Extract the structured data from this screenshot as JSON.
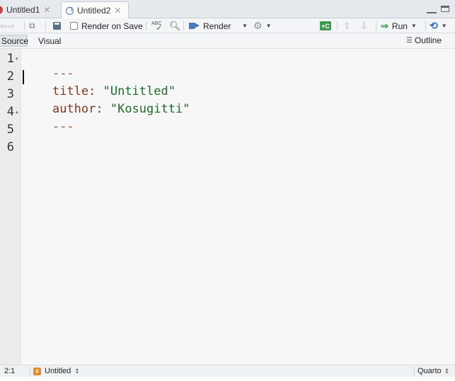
{
  "tabs": [
    {
      "label": "Untitled1",
      "active": false,
      "icon": "r-script-icon"
    },
    {
      "label": "Untitled2",
      "active": true,
      "icon": "quarto-doc-icon"
    }
  ],
  "toolbar": {
    "render_on_save_label": "Render on Save",
    "render_on_save_checked": false,
    "spell_icon_text": "ABC",
    "render_label": "Render",
    "insert_chunk_text": "C",
    "run_label": "Run"
  },
  "modes": {
    "source_label": "Source",
    "visual_label": "Visual",
    "outline_label": "Outline"
  },
  "editor": {
    "lines": [
      {
        "number": "1",
        "fold": "▾",
        "parts": [
          {
            "text": "---",
            "cls": "c-dash"
          }
        ]
      },
      {
        "number": "2",
        "fold": "",
        "parts": [
          {
            "text": "title: ",
            "cls": "c-key"
          },
          {
            "text": "\"Untitled\"",
            "cls": "c-str"
          }
        ]
      },
      {
        "number": "3",
        "fold": "",
        "parts": [
          {
            "text": "author: ",
            "cls": "c-key"
          },
          {
            "text": "\"Kosugitti\"",
            "cls": "c-str"
          }
        ]
      },
      {
        "number": "4",
        "fold": "▴",
        "parts": [
          {
            "text": "---",
            "cls": "c-dash"
          }
        ]
      },
      {
        "number": "5",
        "fold": "",
        "parts": []
      },
      {
        "number": "6",
        "fold": "",
        "parts": []
      }
    ]
  },
  "status": {
    "cursor_pos": "2:1",
    "doc_icon": "#",
    "doc_name": "Untitled",
    "language": "Quarto"
  },
  "colors": {
    "accent_blue": "#4a7db7",
    "chunk_green": "#3f9a4f",
    "yaml_key": "#7a3c25",
    "yaml_string": "#1f6b2a"
  }
}
